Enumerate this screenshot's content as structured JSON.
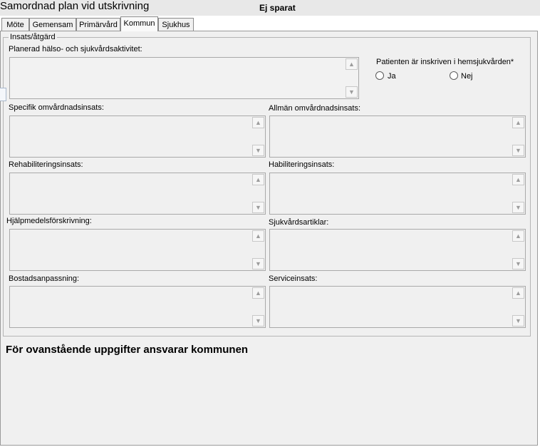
{
  "window": {
    "title": "Samordnad plan vid utskrivning",
    "status": "Ej sparat"
  },
  "tabs": [
    {
      "label": "Möte",
      "active": false
    },
    {
      "label": "Gemensam",
      "active": false
    },
    {
      "label": "Primärvård",
      "active": false
    },
    {
      "label": "Kommun",
      "active": true
    },
    {
      "label": "Sjukhus",
      "active": false
    }
  ],
  "form": {
    "legend": "Insats/åtgärd",
    "planned_label": "Planerad hälso- och sjukvårdsaktivitet:",
    "planned_value": "",
    "homecare_question": "Patienten är inskriven i hemsjukvården*",
    "homecare_options": {
      "yes": "Ja",
      "no": "Nej"
    },
    "fields": {
      "specifik": {
        "label": "Specifik omvårdnadsinsats:",
        "value": ""
      },
      "allman": {
        "label": "Allmän omvårdnadsinsats:",
        "value": ""
      },
      "rehab": {
        "label": "Rehabiliteringsinsats:",
        "value": ""
      },
      "habil": {
        "label": "Habiliteringsinsats:",
        "value": ""
      },
      "hjalpmedel": {
        "label": "Hjälpmedelsförskrivning:",
        "value": ""
      },
      "sjukvardsartiklar": {
        "label": "Sjukvårdsartiklar:",
        "value": ""
      },
      "bostad": {
        "label": "Bostadsanpassning:",
        "value": ""
      },
      "service": {
        "label": "Serviceinsats:",
        "value": ""
      }
    }
  },
  "footer": {
    "text": "För ovanstående uppgifter ansvarar kommunen"
  },
  "icons": {
    "scroll_up": "▲",
    "scroll_down": "▼"
  },
  "colors": {
    "panel_bg": "#f0f0f0",
    "titlebar_bg": "#e8e8e8",
    "border": "#a9a9a9"
  }
}
